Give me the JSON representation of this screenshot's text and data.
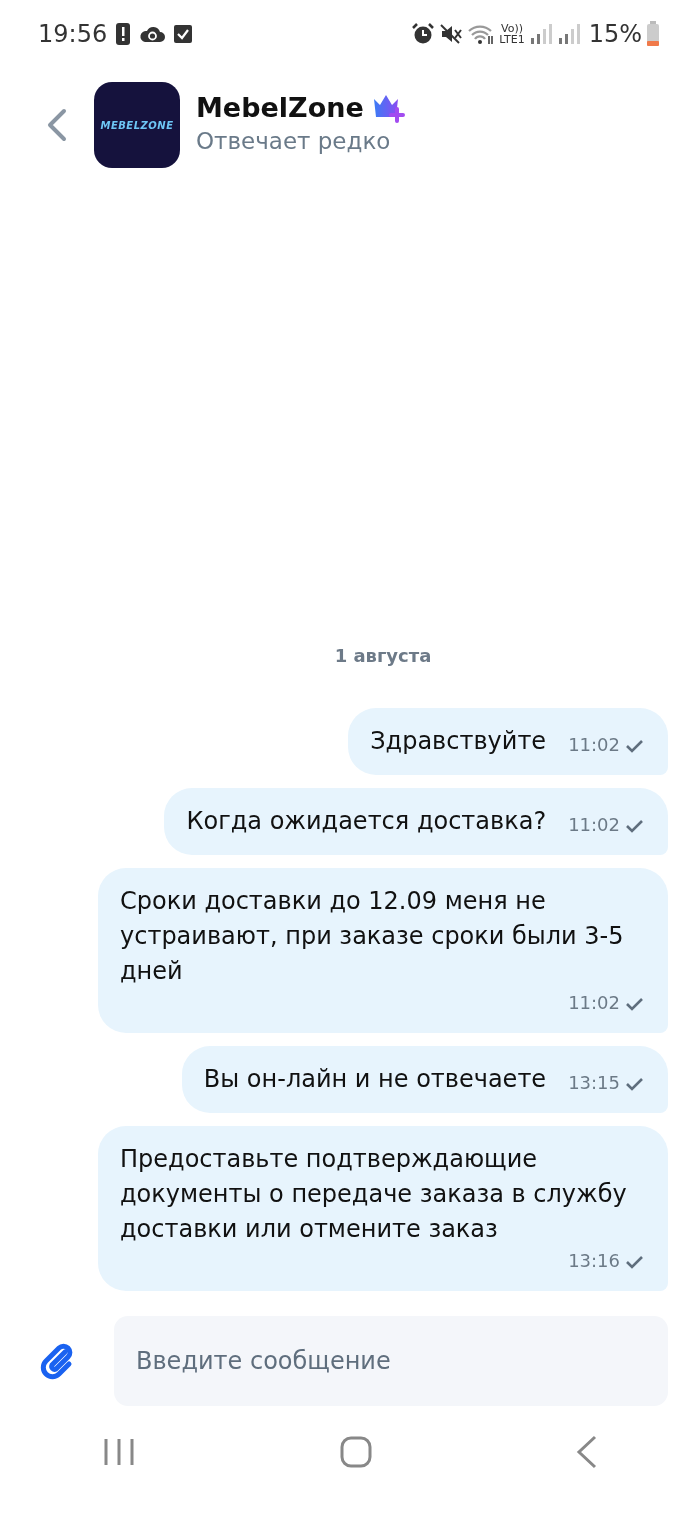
{
  "status_bar": {
    "time": "19:56",
    "volte_top": "Vo))",
    "volte_bottom": "LTE1",
    "battery": "15%"
  },
  "header": {
    "avatar_text": "MEBELZONE",
    "name": "MebelZone",
    "subtitle": "Отвечает редко"
  },
  "date_divider": "1 августа",
  "messages": [
    {
      "text": "Здравствуйте",
      "time": "11:02",
      "sent": true
    },
    {
      "text": "Когда ожидается доставка?",
      "time": "11:02",
      "sent": true
    },
    {
      "text": "Сроки доставки до 12.09 меня не устраивают, при заказе сроки были 3-5 дней",
      "time": "11:02",
      "sent": true
    },
    {
      "text": "Вы он-лайн и не отвечаете",
      "time": "13:15",
      "sent": true
    },
    {
      "text": "Предоставьте подтверждающие документы о передаче заказа в службу доставки или отмените заказ",
      "time": "13:16",
      "sent": true
    }
  ],
  "composer": {
    "placeholder": "Введите сообщение"
  }
}
